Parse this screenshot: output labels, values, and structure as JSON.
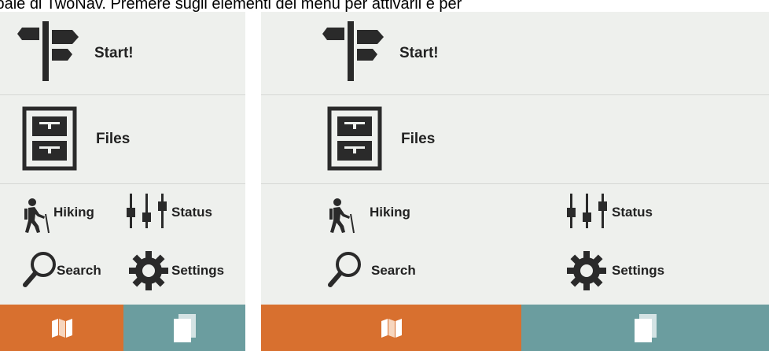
{
  "caption": "ipale di TwoNav. Premere sugli elementi del menu per attivarli e per",
  "colors": {
    "background": "#eef0ed",
    "icon": "#2a2a2a",
    "map_button": "#d8702f",
    "pages_button": "#6b9d9f"
  },
  "menu": {
    "start": {
      "label": "Start!",
      "icon": "signpost-icon"
    },
    "files": {
      "label": "Files",
      "icon": "file-cabinet-icon"
    },
    "hiking": {
      "label": "Hiking",
      "icon": "hiker-icon"
    },
    "status": {
      "label": "Status",
      "icon": "sliders-icon"
    },
    "search": {
      "label": "Search",
      "icon": "magnifier-icon"
    },
    "settings": {
      "label": "Settings",
      "icon": "gear-icon"
    }
  },
  "bottom_bar": {
    "map": {
      "icon": "map-icon"
    },
    "pages": {
      "icon": "pages-icon"
    }
  }
}
